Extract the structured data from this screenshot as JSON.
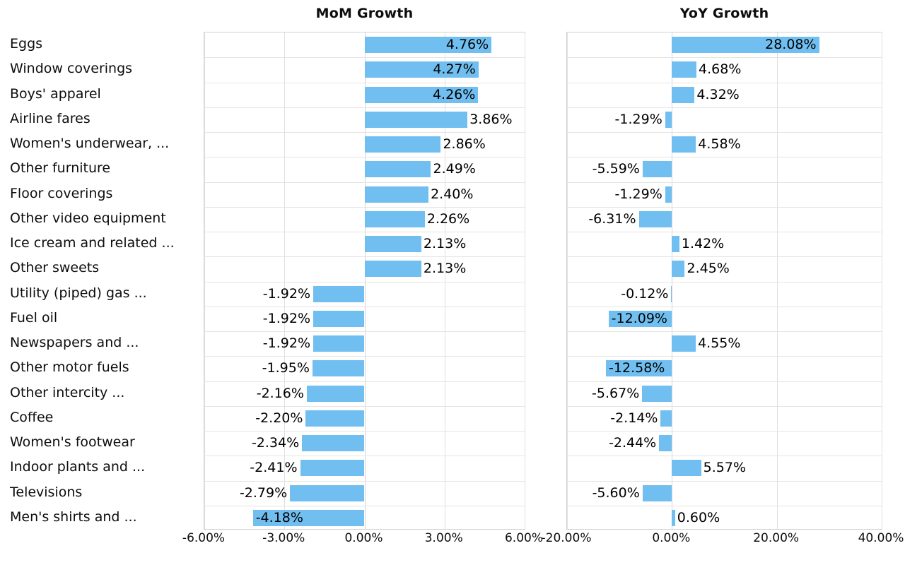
{
  "chart_data": [
    {
      "type": "bar",
      "title": "MoM Growth",
      "orientation": "horizontal",
      "xlabel": "",
      "ylabel": "",
      "xlim": [
        -6,
        6
      ],
      "xticks": [
        -6,
        -3,
        0,
        3,
        6
      ],
      "xtick_labels": [
        "-6.00%",
        "-3.00%",
        "0.00%",
        "3.00%",
        "6.00%"
      ],
      "grid": true,
      "legend": "none",
      "bar_color": "#70bff0",
      "categories": [
        "Eggs",
        "Window coverings",
        "Boys' apparel",
        "Airline fares",
        "Women's underwear, ...",
        "Other furniture",
        "Floor coverings",
        "Other video equipment",
        "Ice cream and related ...",
        "Other sweets",
        "Utility (piped) gas ...",
        "Fuel oil",
        "Newspapers and ...",
        "Other motor fuels",
        "Other intercity ...",
        "Coffee",
        "Women's footwear",
        "Indoor plants and ...",
        "Televisions",
        "Men's shirts and ..."
      ],
      "values": [
        4.76,
        4.27,
        4.26,
        3.86,
        2.86,
        2.49,
        2.4,
        2.26,
        2.13,
        2.13,
        -1.92,
        -1.92,
        -1.92,
        -1.95,
        -2.16,
        -2.2,
        -2.34,
        -2.41,
        -2.79,
        -4.18
      ],
      "data_labels": [
        "4.76%",
        "4.27%",
        "4.26%",
        "3.86%",
        "2.86%",
        "2.49%",
        "2.40%",
        "2.26%",
        "2.13%",
        "2.13%",
        "-1.92%",
        "-1.92%",
        "-1.92%",
        "-1.95%",
        "-2.16%",
        "-2.20%",
        "-2.34%",
        "-2.41%",
        "-2.79%",
        "-4.18%"
      ],
      "label_placement": [
        "inside",
        "inside",
        "inside",
        "outside",
        "outside",
        "outside",
        "outside",
        "outside",
        "outside",
        "outside",
        "outside",
        "outside",
        "outside",
        "outside",
        "outside",
        "outside",
        "outside",
        "outside",
        "outside",
        "inside"
      ]
    },
    {
      "type": "bar",
      "title": "YoY Growth",
      "orientation": "horizontal",
      "xlabel": "",
      "ylabel": "",
      "xlim": [
        -20,
        40
      ],
      "xticks": [
        -20,
        0,
        20,
        40
      ],
      "xtick_labels": [
        "-20.00%",
        "0.00%",
        "20.00%",
        "40.00%"
      ],
      "grid": true,
      "legend": "none",
      "bar_color": "#70bff0",
      "categories": [
        "Eggs",
        "Window coverings",
        "Boys' apparel",
        "Airline fares",
        "Women's underwear, ...",
        "Other furniture",
        "Floor coverings",
        "Other video equipment",
        "Ice cream and related ...",
        "Other sweets",
        "Utility (piped) gas ...",
        "Fuel oil",
        "Newspapers and ...",
        "Other motor fuels",
        "Other intercity ...",
        "Coffee",
        "Women's footwear",
        "Indoor plants and ...",
        "Televisions",
        "Men's shirts and ..."
      ],
      "values": [
        28.08,
        4.68,
        4.32,
        -1.29,
        4.58,
        -5.59,
        -1.29,
        -6.31,
        1.42,
        2.45,
        -0.12,
        -12.09,
        4.55,
        -12.58,
        -5.67,
        -2.14,
        -2.44,
        5.57,
        -5.6,
        0.6
      ],
      "data_labels": [
        "28.08%",
        "4.68%",
        "4.32%",
        "-1.29%",
        "4.58%",
        "-5.59%",
        "-1.29%",
        "-6.31%",
        "1.42%",
        "2.45%",
        "-0.12%",
        "-12.09%",
        "4.55%",
        "-12.58%",
        "-5.67%",
        "-2.14%",
        "-2.44%",
        "5.57%",
        "-5.60%",
        "0.60%"
      ],
      "label_placement": [
        "inside",
        "outside",
        "outside",
        "outside",
        "outside",
        "outside",
        "outside",
        "outside",
        "outside",
        "outside",
        "outside",
        "inside",
        "outside",
        "inside",
        "outside",
        "outside",
        "outside",
        "outside",
        "outside",
        "outside"
      ]
    }
  ]
}
